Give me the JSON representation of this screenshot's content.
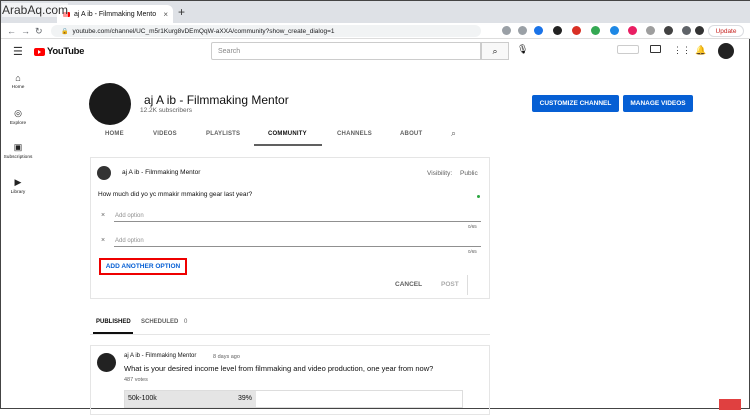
{
  "watermark": "ArabAq.com",
  "browser": {
    "tab_title": "aj A  ib  - Filmmaking Mento",
    "tab_close": "×",
    "new_tab": "+",
    "url": "youtube.com/channel/UC_m5r1Kurg8vDEmQqW-aXXA/community?show_create_dialog=1",
    "update_label": "Update",
    "nav": {
      "back": "←",
      "forward": "→",
      "reload": "↻",
      "lock": "🔒"
    }
  },
  "header": {
    "menu_glyph": "☰",
    "logo_text": "YouTube",
    "search_placeholder": "Search",
    "search_glyph": "⌕",
    "mic_glyph": "🎙"
  },
  "sidenav": [
    {
      "label": "Home",
      "glyph": "⌂"
    },
    {
      "label": "Explore",
      "glyph": "◎"
    },
    {
      "label": "Subscriptions",
      "glyph": "▣"
    },
    {
      "label": "Library",
      "glyph": "▶"
    }
  ],
  "channel": {
    "name": "aj A  ib   - Filmmaking Mentor",
    "subscribers": "12.2K subscribers",
    "customize_label": "CUSTOMIZE CHANNEL",
    "manage_label": "MANAGE VIDEOS",
    "tabs": [
      "HOME",
      "VIDEOS",
      "PLAYLISTS",
      "COMMUNITY",
      "CHANNELS",
      "ABOUT"
    ],
    "active_tab": "COMMUNITY",
    "tab_search_glyph": "⌕"
  },
  "dialog": {
    "author": "aj A  ib   - Filmmaking Mentor",
    "visibility_label": "Visibility:",
    "visibility_value": "Public",
    "question": "How much did yo yc mmakir mmaking gear last year?",
    "options": [
      {
        "remove_glyph": "×",
        "placeholder": "Add option",
        "count": "0/65"
      },
      {
        "remove_glyph": "×",
        "placeholder": "Add option",
        "count": "0/65"
      }
    ],
    "add_option_label": "ADD ANOTHER OPTION",
    "cancel_label": "CANCEL",
    "post_label": "POST"
  },
  "post_tabs": {
    "published_label": "PUBLISHED",
    "scheduled_label": "SCHEDULED",
    "scheduled_count": "0"
  },
  "poll_post": {
    "author": "aj A  ib  - Filmmaking Mentor",
    "time": "8 days ago",
    "question": "What is your desired income level from filmmaking and video production, one year from now?",
    "votes": "487 votes",
    "option_label": "50k-100k",
    "option_percent": "39%",
    "option_fraction": 0.39
  },
  "colors": {
    "accent_blue": "#065fd4",
    "highlight_red": "#ee0000",
    "youtube_red": "#ff0000"
  }
}
